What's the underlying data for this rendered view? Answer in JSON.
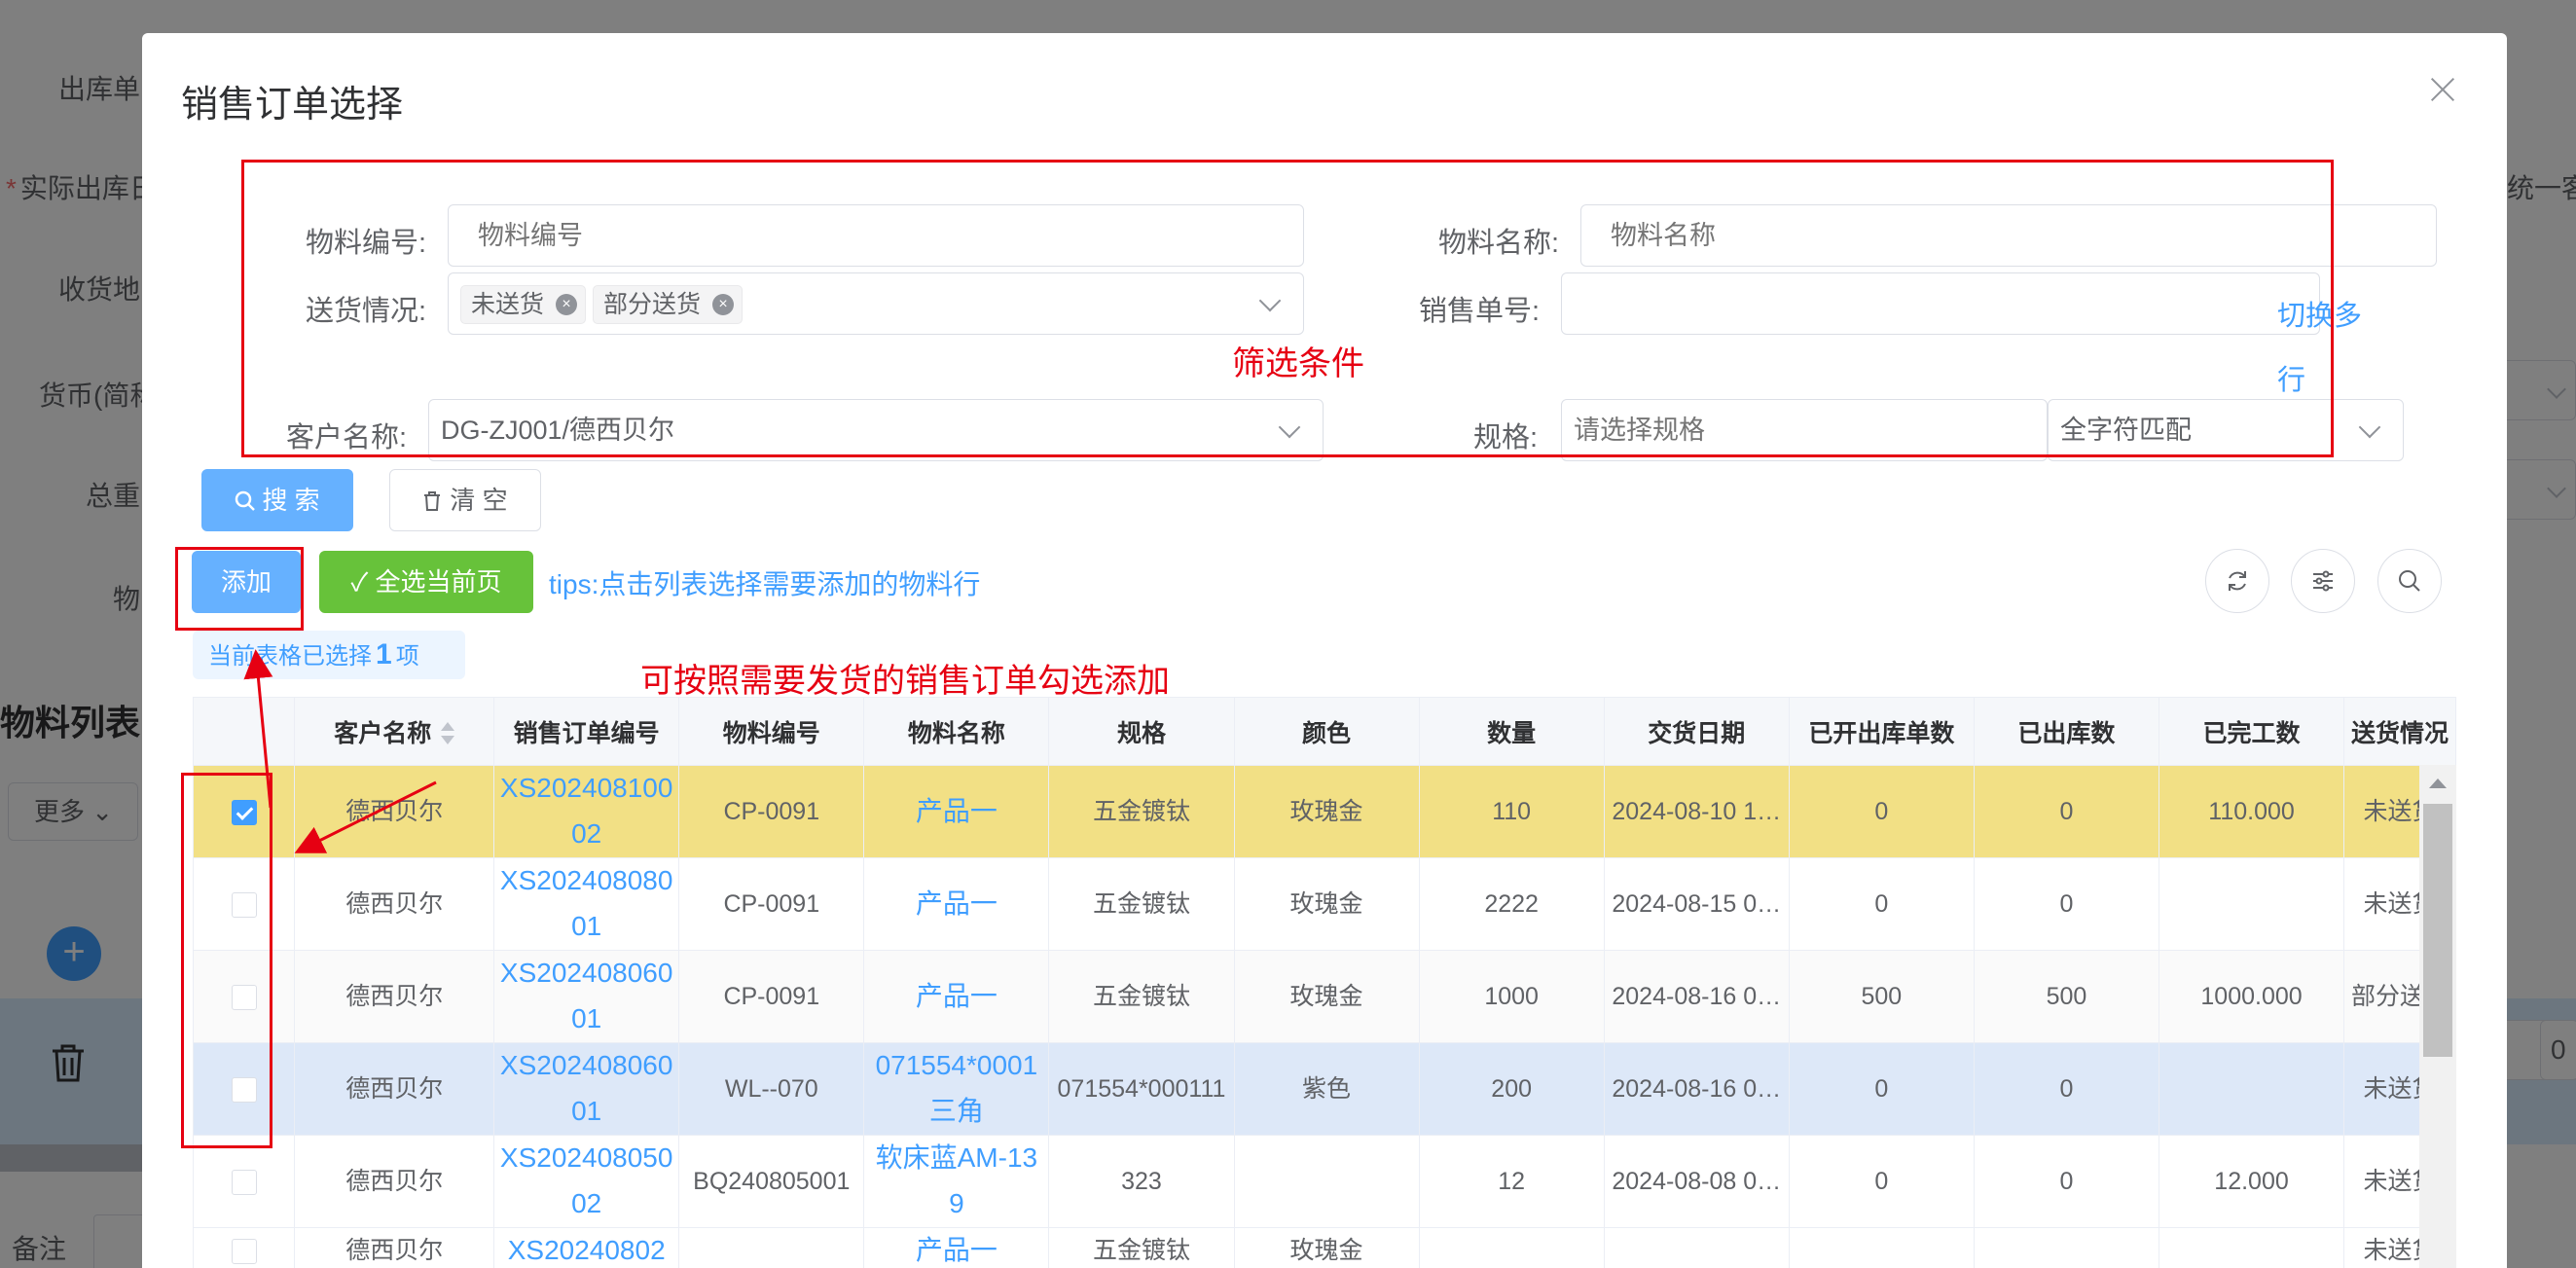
{
  "background": {
    "labels": [
      "出库单",
      "实际出库日",
      "收货地",
      "货币(简称",
      "总重",
      "物"
    ],
    "required_mark": "*",
    "section_title": "物料列表",
    "more_button": "更多",
    "right_partial": "统一客",
    "right_input_partial": "0",
    "note_label": "备注"
  },
  "dialog": {
    "title": "销售订单选择"
  },
  "filters": {
    "material_code_label": "物料编号:",
    "material_code_placeholder": "物料编号",
    "material_name_label": "物料名称:",
    "material_name_placeholder": "物料名称",
    "delivery_label": "送货情况:",
    "delivery_tags": [
      "未送货",
      "部分送货"
    ],
    "sales_no_label": "销售单号:",
    "sales_no_value": "",
    "switch_multiline": "切换多行",
    "customer_label": "客户名称:",
    "customer_value": "DG-ZJ001/德西贝尔",
    "spec_label": "规格:",
    "spec_placeholder": "请选择规格",
    "match_mode": "全字符匹配"
  },
  "toolbar": {
    "search": "搜 索",
    "clear": "清 空",
    "add": "添加",
    "select_all_page": "全选当前页",
    "tips": "tips:点击列表选择需要添加的物料行",
    "selected_prefix": "当前表格已选择",
    "selected_count": "1",
    "selected_suffix": "项"
  },
  "annotations": {
    "filter_box": "筛选条件",
    "table_hint": "可按照需要发货的销售订单勾选添加"
  },
  "table": {
    "headers": [
      "客户名称",
      "销售订单编号",
      "物料编号",
      "物料名称",
      "规格",
      "颜色",
      "数量",
      "交货日期",
      "已开出库单数",
      "已出库数",
      "已完工数",
      "送货情况"
    ],
    "rows": [
      {
        "checked": true,
        "customer": "德西贝尔",
        "order": "XS20240810002",
        "code": "CP-0091",
        "name": "产品一",
        "spec": "五金镀钛",
        "color": "玫瑰金",
        "qty": "110",
        "date": "2024-08-10 1…",
        "opened": "0",
        "out": "0",
        "done": "110.000",
        "status": "未送货"
      },
      {
        "checked": false,
        "customer": "德西贝尔",
        "order": "XS20240808001",
        "code": "CP-0091",
        "name": "产品一",
        "spec": "五金镀钛",
        "color": "玫瑰金",
        "qty": "2222",
        "date": "2024-08-15 0…",
        "opened": "0",
        "out": "0",
        "done": "",
        "status": "未送货"
      },
      {
        "checked": false,
        "customer": "德西贝尔",
        "order": "XS20240806001",
        "code": "CP-0091",
        "name": "产品一",
        "spec": "五金镀钛",
        "color": "玫瑰金",
        "qty": "1000",
        "date": "2024-08-16 0…",
        "opened": "500",
        "out": "500",
        "done": "1000.000",
        "status": "部分送货"
      },
      {
        "checked": false,
        "customer": "德西贝尔",
        "order": "XS20240806001",
        "code": "WL--070",
        "name": "071554*0001三角",
        "spec": "071554*000111",
        "color": "紫色",
        "qty": "200",
        "date": "2024-08-16 0…",
        "opened": "0",
        "out": "0",
        "done": "",
        "status": "未送货"
      },
      {
        "checked": false,
        "customer": "德西贝尔",
        "order": "XS20240805002",
        "code": "BQ240805001",
        "name": "软床蓝AM-139",
        "spec": "323",
        "color": "",
        "qty": "12",
        "date": "2024-08-08 0…",
        "opened": "0",
        "out": "0",
        "done": "12.000",
        "status": "未送货"
      },
      {
        "checked": false,
        "customer": "德西贝尔",
        "order": "XS20240802",
        "code": "",
        "name": "产品一",
        "spec": "五金镀钛",
        "color": "玫瑰金",
        "qty": "",
        "date": "",
        "opened": "",
        "out": "",
        "done": "",
        "status": "未送货"
      }
    ]
  }
}
